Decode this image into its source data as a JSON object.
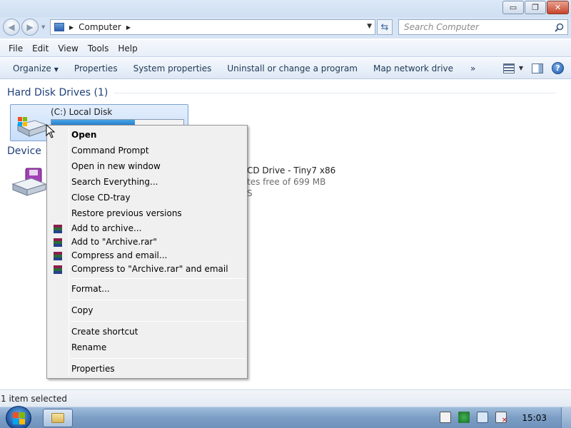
{
  "window": {
    "caption_buttons": {
      "minimize": "▭",
      "restore": "❐",
      "close": "✕"
    }
  },
  "address": {
    "location": "Computer",
    "search_placeholder": "Search Computer"
  },
  "menubar": {
    "items": [
      {
        "label": "File"
      },
      {
        "label": "Edit"
      },
      {
        "label": "View"
      },
      {
        "label": "Tools"
      },
      {
        "label": "Help"
      }
    ]
  },
  "commandbar": {
    "items": [
      {
        "label": "Organize"
      },
      {
        "label": "Properties"
      },
      {
        "label": "System properties"
      },
      {
        "label": "Uninstall or change a program"
      },
      {
        "label": "Map network drive"
      }
    ],
    "more": "»"
  },
  "content": {
    "hard_disk_header": "Hard Disk Drives (1)",
    "devices_header": "Device",
    "drive_c": {
      "name": "(C:) Local Disk",
      "usage_fraction": 0.63
    },
    "cd_drive": {
      "name": "CD Drive - Tiny7 x86",
      "free": "tes free of 699 MB",
      "fs": "S"
    }
  },
  "context_menu": {
    "items": [
      {
        "label": "Open",
        "bold": true
      },
      {
        "label": "Command Prompt"
      },
      {
        "label": "Open in new window"
      },
      {
        "label": "Search Everything..."
      },
      {
        "label": "Close CD-tray"
      },
      {
        "label": "Restore previous versions"
      },
      {
        "label": "Add to archive...",
        "icon": "winrar-icon"
      },
      {
        "label": "Add to \"Archive.rar\"",
        "icon": "winrar-icon"
      },
      {
        "label": "Compress and email...",
        "icon": "winrar-icon"
      },
      {
        "label": "Compress to \"Archive.rar\" and email",
        "icon": "winrar-icon"
      },
      {
        "label": "Format..."
      },
      {
        "label": "Copy"
      },
      {
        "label": "Create shortcut"
      },
      {
        "label": "Rename"
      },
      {
        "label": "Properties"
      }
    ]
  },
  "statusbar": {
    "text": "1 item selected"
  },
  "taskbar": {
    "clock": "15:03"
  },
  "colors": {
    "accent": "#1d6fc0",
    "selection": "#c8defa",
    "taskbar": "#7c9ec5"
  }
}
